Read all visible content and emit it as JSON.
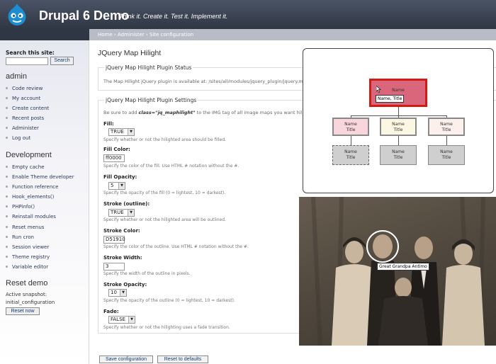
{
  "header": {
    "site_name": "Drupal 6 Demo",
    "slogan": "Think it. Create it. Test it. Implement it."
  },
  "breadcrumb": "Home › Administer › Site configuration",
  "sidebar": {
    "search_label": "Search this site:",
    "search_button": "Search",
    "user_title": "admin",
    "user_items": [
      "Code review",
      "My account",
      "Create content",
      "Recent posts",
      "Administer",
      "Log out"
    ],
    "dev_title": "Development",
    "dev_items": [
      "Empty cache",
      "Enable Theme developer",
      "Function reference",
      "Hook_elements()",
      "PHPinfo()",
      "Reinstall modules",
      "Reset menus",
      "Run cron",
      "Session viewer",
      "Theme registry",
      "Variable editor"
    ],
    "reset_title": "Reset demo",
    "snapshot_label": "Active snapshot:",
    "snapshot_value": "initial_configuration",
    "reset_button": "Reset now"
  },
  "main": {
    "page_title": "JQuery Map Hilight",
    "status_legend": "jQuery Map Hilight Plugin Status",
    "status_text": "The Map Hilight jQuery plugin is available at: /sites/all/modules/jquery_plugin/jquery.m",
    "settings_legend": "jQuery Map Hilight Plugin Settings",
    "settings_note_prefix": "Be sure to add ",
    "settings_note_code": "class=\"jq_maphilight\"",
    "settings_note_suffix": " to the IMG tag of all image maps you want hil",
    "fields": [
      {
        "label": "Fill:",
        "type": "select",
        "value": "TRUE",
        "desc": "Specify whether or not the hilighted area should be filled."
      },
      {
        "label": "Fill Color:",
        "type": "text",
        "value": "ff0000",
        "desc": "Specify the color of the fill. Use HTML # notation without the #."
      },
      {
        "label": "Fill Opacity:",
        "type": "select",
        "value": "5",
        "desc": "Specify the opacity of the fill (0 = lightest, 10 = darkest)."
      },
      {
        "label": "Stroke (outline):",
        "type": "select",
        "value": "TRUE",
        "desc": "Specify whether or not the hilighted area will be outlined."
      },
      {
        "label": "Stroke Color:",
        "type": "text",
        "value": "D51910",
        "desc": "Specify the color of the outline. Use HTML # notation without the #."
      },
      {
        "label": "Stroke Width:",
        "type": "text",
        "value": "3",
        "desc": "Specify the width of the outline in pixels."
      },
      {
        "label": "Stroke Opacity:",
        "type": "select",
        "value": "10",
        "desc": "Specify the opacity of the outline (0 = lightest, 10 = darkest)."
      },
      {
        "label": "Fade:",
        "type": "select",
        "value": "FALSE",
        "desc": "Specify whether or not the hilighting uses a fade transition."
      }
    ],
    "save_button": "Save configuration",
    "reset_defaults_button": "Reset to defaults"
  },
  "orgchart": {
    "top_node": [
      "Name",
      "Title"
    ],
    "tooltip": "Name, Title",
    "mid_nodes": [
      [
        "Name",
        "Title"
      ],
      [
        "Name",
        "Title"
      ],
      [
        "Name",
        "Title"
      ]
    ],
    "bottom_nodes": [
      [
        "Name",
        "Title"
      ],
      [
        "Name",
        "Title"
      ],
      [
        "Name",
        "Title"
      ]
    ]
  },
  "photo": {
    "label": "Great Grandpa Antimo"
  },
  "colors": {
    "header_bg": "#3a4252",
    "highlight_fill": "#d9667a",
    "highlight_stroke": "#d51910",
    "link": "#123a7a"
  }
}
